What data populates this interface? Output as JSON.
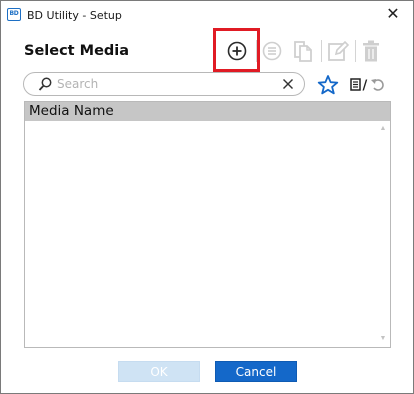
{
  "window": {
    "app_icon_text": "BD",
    "title": "BD Utility - Setup",
    "close_glyph": "✕"
  },
  "header": {
    "title": "Select Media"
  },
  "toolbar": {
    "items": [
      {
        "icon": "add-circle-icon",
        "enabled": true,
        "highlighted": true
      },
      {
        "icon": "list-circle-icon",
        "enabled": false
      },
      {
        "icon": "copy-icon",
        "enabled": false
      },
      {
        "icon": "edit-icon",
        "enabled": false
      },
      {
        "icon": "delete-icon",
        "enabled": false
      }
    ],
    "highlight_color": "#e01b24"
  },
  "search": {
    "value": "",
    "placeholder": "Search"
  },
  "filters": {
    "favorite_icon": "star-icon",
    "toggle_icons": [
      "document-icon",
      "refresh-icon"
    ],
    "toggle_separator": "/"
  },
  "list": {
    "columns": [
      "Media Name"
    ],
    "rows": []
  },
  "footer": {
    "ok_label": "OK",
    "cancel_label": "Cancel",
    "ok_enabled": false
  },
  "colors": {
    "accent": "#1468c9",
    "accent_disabled": "#cfe3f4",
    "star": "#1468c9",
    "header_bg": "#c6c6c6"
  }
}
